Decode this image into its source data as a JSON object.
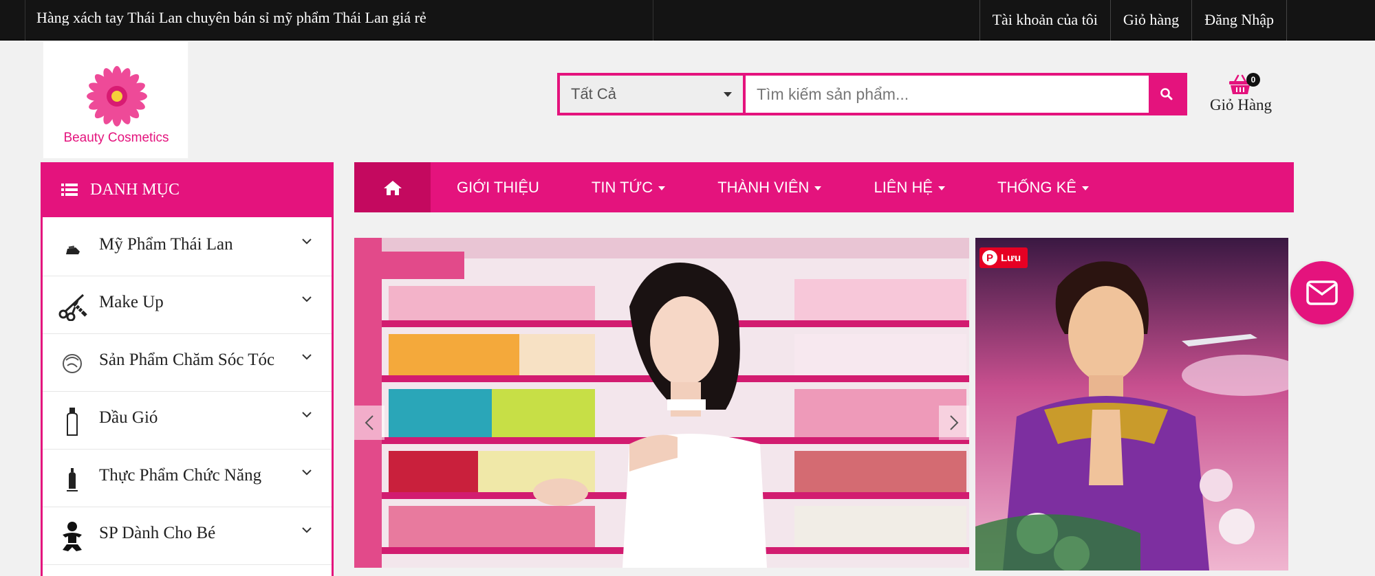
{
  "topbar": {
    "marquee": "Hàng xách tay Thái Lan chuyên bán sỉ mỹ phẩm Thái Lan giá rẻ",
    "links": [
      "Tài khoản của tôi",
      "Giỏ hàng",
      "Đăng Nhập"
    ]
  },
  "logo": {
    "text": "Beauty Cosmetics"
  },
  "search": {
    "category": "Tất Cả",
    "placeholder": "Tìm kiếm sản phẩm..."
  },
  "cart": {
    "count": "0",
    "label": "Giỏ Hàng"
  },
  "sidebar": {
    "title": "DANH MỤC",
    "items": [
      {
        "label": "Mỹ Phẩm Thái Lan",
        "icon": "lipstick-icon"
      },
      {
        "label": "Make Up",
        "icon": "scissors-comb-icon"
      },
      {
        "label": "Sản Phẩm Chăm Sóc Tóc",
        "icon": "hair-care-icon"
      },
      {
        "label": "Dầu Gió",
        "icon": "oil-bottle-icon"
      },
      {
        "label": "Thực Phẩm Chức Năng",
        "icon": "supplement-bottle-icon"
      },
      {
        "label": "SP Dành Cho Bé",
        "icon": "baby-icon"
      }
    ]
  },
  "nav": {
    "items": [
      {
        "label": "GIỚI THIỆU",
        "dropdown": false
      },
      {
        "label": "TIN TỨC",
        "dropdown": true
      },
      {
        "label": "THÀNH VIÊN",
        "dropdown": true
      },
      {
        "label": "LIÊN HỆ",
        "dropdown": true
      },
      {
        "label": "THỐNG KÊ",
        "dropdown": true
      }
    ]
  },
  "banner": {
    "pin_label": "Lưu"
  },
  "colors": {
    "brand": "#e4137d",
    "brand_dark": "#c4095f",
    "topbar": "#141414"
  }
}
